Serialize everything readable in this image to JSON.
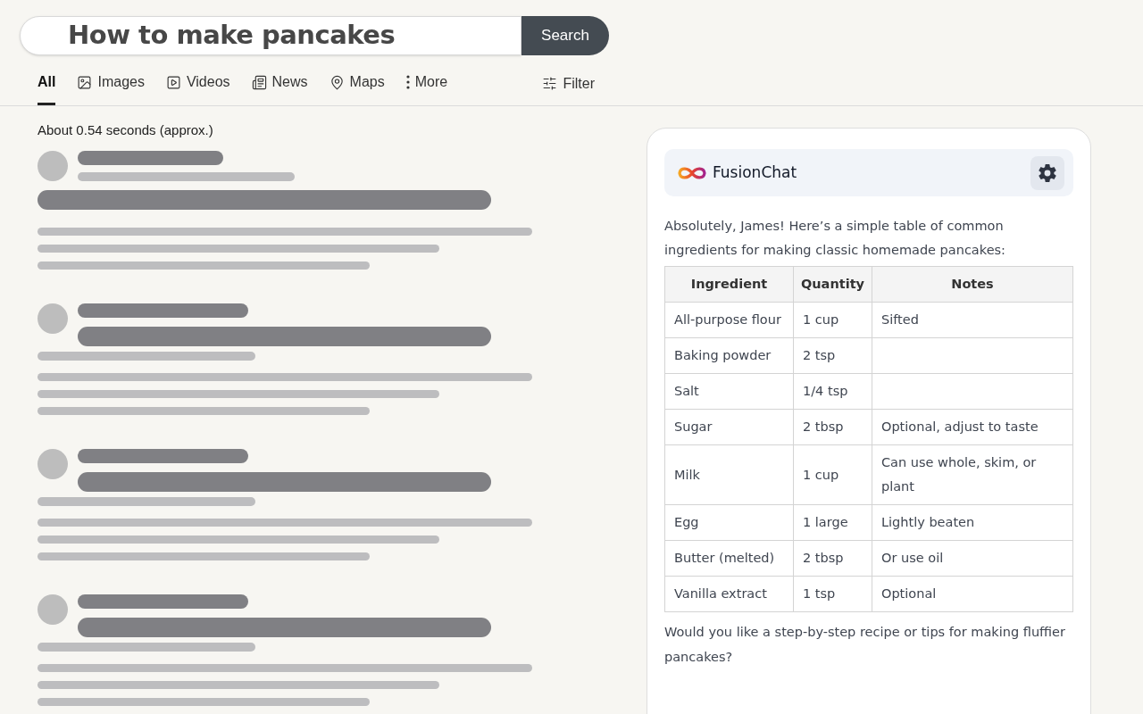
{
  "search": {
    "value": "How to make pancakes",
    "button": "Search"
  },
  "tabs": [
    {
      "label": "All",
      "kind": "plain",
      "selected": true
    },
    {
      "label": "Images",
      "kind": "image",
      "selected": false
    },
    {
      "label": "Videos",
      "kind": "play",
      "selected": false
    },
    {
      "label": "News",
      "kind": "news",
      "selected": false
    },
    {
      "label": "Maps",
      "kind": "pin",
      "selected": false
    },
    {
      "label": "More",
      "kind": "dots",
      "selected": false
    }
  ],
  "filter": "Filter",
  "stats": "About 0.54 seconds (approx.)",
  "results": [
    {
      "kind": "lead"
    },
    {
      "kind": "standard"
    },
    {
      "kind": "standard"
    },
    {
      "kind": "standard"
    }
  ],
  "chat": {
    "title": "FusionChat",
    "intro": "Absolutely, James! Here’s a simple table of common ingredients for making classic homemade pancakes:",
    "columns": [
      "Ingredient",
      "Quantity",
      "Notes"
    ],
    "rows": [
      [
        "All-purpose flour",
        "1 cup",
        "Sifted"
      ],
      [
        "Baking powder",
        "2 tsp",
        ""
      ],
      [
        "Salt",
        "1/4 tsp",
        ""
      ],
      [
        "Sugar",
        "2 tbsp",
        "Optional, adjust to taste"
      ],
      [
        "Milk",
        "1 cup",
        "Can use whole, skim, or plant"
      ],
      [
        "Egg",
        "1 large",
        "Lightly beaten"
      ],
      [
        "Butter (melted)",
        "2 tbsp",
        "Or use oil"
      ],
      [
        "Vanilla extract",
        "1 tsp",
        "Optional"
      ]
    ],
    "outro": "Would you like a step-by-step recipe or tips for making fluffier pancakes?"
  }
}
